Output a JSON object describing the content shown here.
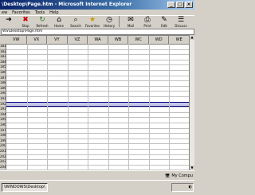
{
  "window": {
    "title": "\\Desktop\\Page.htm - Microsoft Internet Explorer",
    "controls": [
      "_",
      "□",
      "×"
    ]
  },
  "menu": [
    "ew",
    "Favorites",
    "Tools",
    "Help"
  ],
  "toolbar": [
    {
      "label": "",
      "icon": "forward-arrow-icon"
    },
    {
      "label": "Stop",
      "icon": "stop-icon"
    },
    {
      "label": "Refresh",
      "icon": "refresh-icon"
    },
    {
      "label": "Home",
      "icon": "home-icon"
    },
    {
      "label": "Search",
      "icon": "search-icon"
    },
    {
      "label": "Favorites",
      "icon": "favorites-icon"
    },
    {
      "label": "History",
      "icon": "history-icon"
    },
    {
      "label": "",
      "icon": "separator"
    },
    {
      "label": "Mail",
      "icon": "mail-icon"
    },
    {
      "label": "Print",
      "icon": "print-icon"
    },
    {
      "label": "Edit",
      "icon": "edit-icon"
    },
    {
      "label": "Discuss",
      "icon": "discuss-icon"
    }
  ],
  "address": {
    "value": "WS\\Desktop\\Page.htm"
  },
  "sheet": {
    "columns": [
      "VW",
      "VX",
      "VY",
      "VZ",
      "WA",
      "WB",
      "WC",
      "WD",
      "WE"
    ],
    "rows": [
      "181",
      "182",
      "183",
      "184",
      "185",
      "186",
      "187",
      "188",
      "189",
      "190",
      "191",
      "192",
      "193",
      "194",
      "195",
      "196",
      "197",
      "198",
      "199",
      "200",
      "201",
      "202",
      "203",
      "204"
    ],
    "selected_row_index": 11
  },
  "status": {
    "left": "",
    "zone": "My Compu"
  },
  "taskbar": {
    "task": "\\WINDOWS\\Desktop\\"
  }
}
